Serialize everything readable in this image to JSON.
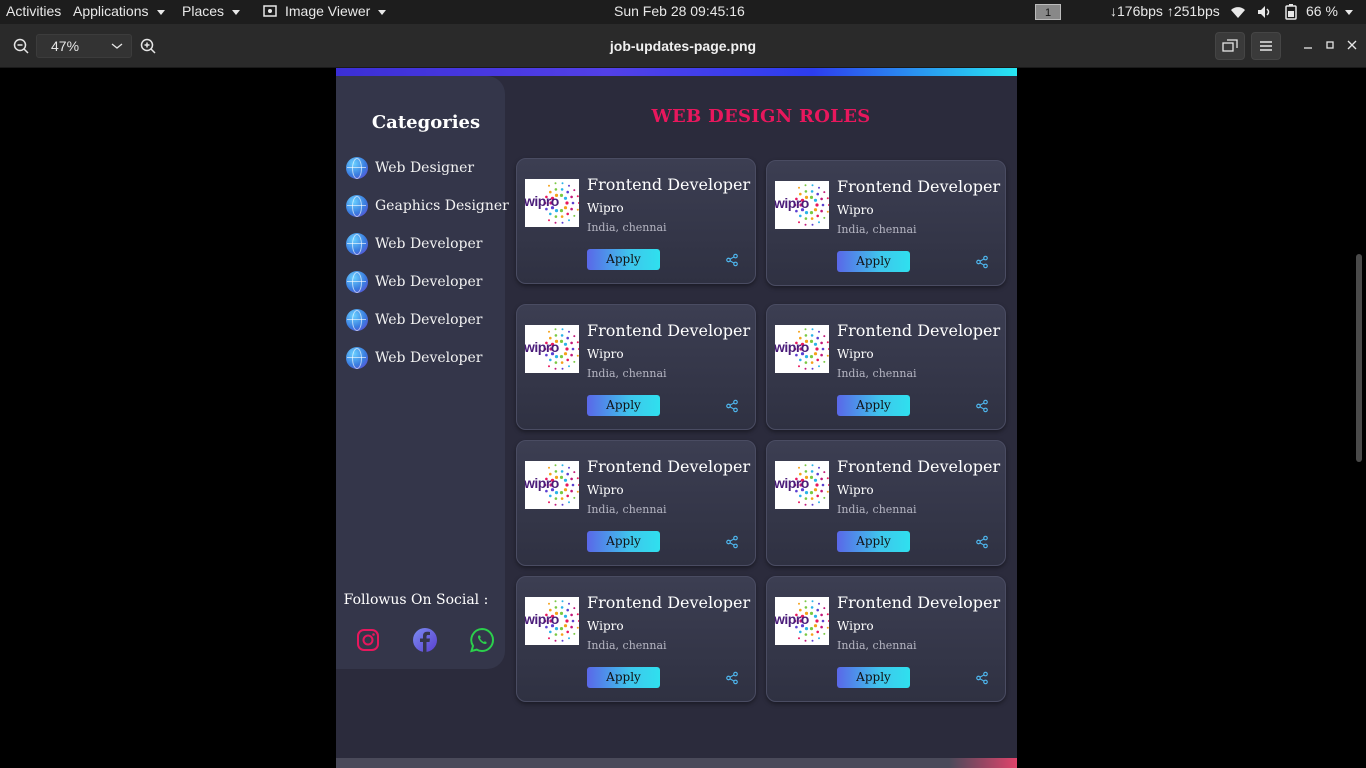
{
  "topbar": {
    "activities": "Activities",
    "applications": "Applications",
    "places": "Places",
    "app_name": "Image Viewer",
    "clock": "Sun Feb 28  09:45:16",
    "workspace": "1",
    "network": "↓176bps ↑251bps",
    "battery": "66 %"
  },
  "viewer": {
    "zoom": "47%",
    "title": "job-updates-page.png"
  },
  "sidebar": {
    "title": "Categories",
    "items": [
      {
        "label": "Web Designer"
      },
      {
        "label": "Geaphics Designer"
      },
      {
        "label": "Web Developer"
      },
      {
        "label": "Web Developer"
      },
      {
        "label": "Web Developer"
      },
      {
        "label": "Web Developer"
      }
    ],
    "follow": "Followus On Social :"
  },
  "main": {
    "title": "WEB DESIGN ROLES",
    "jobs": [
      {
        "title": "Frontend Developer",
        "company": "Wipro",
        "location": "India, chennai",
        "apply": "Apply",
        "logo": "wipro"
      },
      {
        "title": "Frontend Developer",
        "company": "Wipro",
        "location": "India, chennai",
        "apply": "Apply",
        "logo": "wipro"
      },
      {
        "title": "Frontend Developer",
        "company": "Wipro",
        "location": "India, chennai",
        "apply": "Apply",
        "logo": "wipro"
      },
      {
        "title": "Frontend Developer",
        "company": "Wipro",
        "location": "India, chennai",
        "apply": "Apply",
        "logo": "wipro"
      },
      {
        "title": "Frontend Developer",
        "company": "Wipro",
        "location": "India, chennai",
        "apply": "Apply",
        "logo": "wipro"
      },
      {
        "title": "Frontend Developer",
        "company": "Wipro",
        "location": "India, chennai",
        "apply": "Apply",
        "logo": "wipro"
      },
      {
        "title": "Frontend Developer",
        "company": "Wipro",
        "location": "India, chennai",
        "apply": "Apply",
        "logo": "wipro"
      },
      {
        "title": "Frontend Developer",
        "company": "Wipro",
        "location": "India, chennai",
        "apply": "Apply",
        "logo": "wipro"
      }
    ]
  },
  "colors": {
    "accent_title": "#e8175d",
    "apply_gradient_start": "#5a67e8",
    "apply_gradient_end": "#2fe0ee",
    "page_bg": "#2b2b3c",
    "sidebar_bg": "#34364a"
  }
}
